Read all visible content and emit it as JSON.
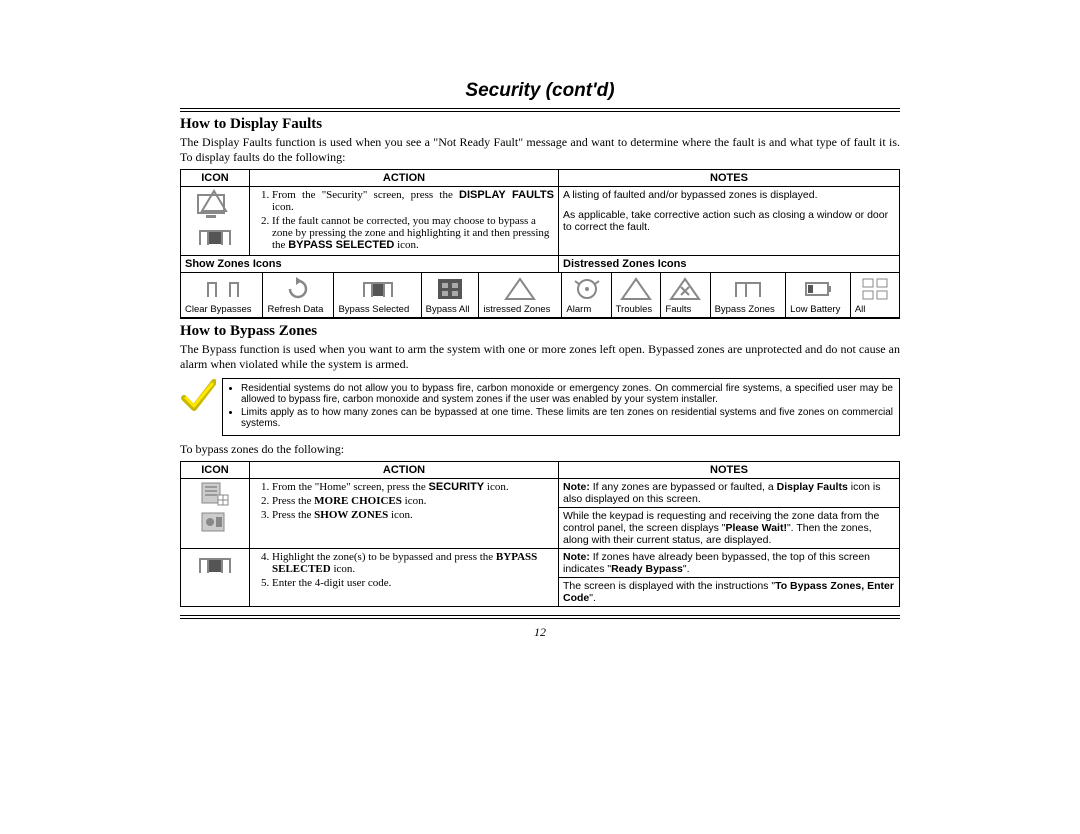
{
  "page_title": "Security (cont'd)",
  "page_number": "12",
  "s1": {
    "title": "How to Display Faults",
    "intro": "The Display Faults function is used when you see a \"Not Ready Fault\" message and want to determine where the fault is and what type of fault it is.  To display faults do the following:",
    "hdr_icon": "ICON",
    "hdr_action": "ACTION",
    "hdr_notes": "NOTES",
    "step1_a": "From the \"Security\" screen, press the ",
    "step1_b": "DISPLAY FAULTS",
    "step1_c": " icon.",
    "step2_a": "If the fault cannot be corrected, you may choose to bypass a zone by pressing the zone and highlighting it and then pressing the ",
    "step2_b": "BYPASS SELECTED",
    "step2_c": " icon.",
    "note1": "A listing of faulted and/or bypassed zones is displayed.",
    "note2": "As applicable, take corrective action such as closing a window or door to correct the fault.",
    "sub_left": "Show Zones Icons",
    "sub_right": "Distressed Zones Icons",
    "icons": [
      "Clear Bypasses",
      "Refresh Data",
      "Bypass Selected",
      "Bypass All",
      "istressed Zones",
      "Alarm",
      "Troubles",
      "Faults",
      "Bypass Zones",
      "Low Battery",
      "All"
    ]
  },
  "s2": {
    "title": "How to Bypass Zones",
    "intro": "The Bypass function is used when you want to arm the system with one or more zones left open. Bypassed zones are unprotected and do not cause an alarm when violated while the system is armed.",
    "bullet1": "Residential systems do not allow you to bypass fire, carbon monoxide or emergency zones. On commercial fire systems, a specified user may be allowed to bypass fire, carbon monoxide and system zones if the user was enabled by your system installer.",
    "bullet2": "Limits apply as to how many zones can be bypassed at one time. These limits are ten zones on residential systems and five zones on commercial systems.",
    "lead": "To bypass zones do the following:",
    "hdr_icon": "ICON",
    "hdr_action": "ACTION",
    "hdr_notes": "NOTES",
    "r1s1_a": "From the \"Home\" screen, press the ",
    "r1s1_b": "SECURITY",
    "r1s1_c": " icon.",
    "r1s2_a": "Press the ",
    "r1s2_b": "MORE CHOICES",
    "r1s2_c": " icon.",
    "r1s3_a": "Press the ",
    "r1s3_b": "SHOW ZONES",
    "r1s3_c": " icon.",
    "r1n1_a": "Note:",
    "r1n1_b": " If any zones are bypassed or faulted, a ",
    "r1n1_c": "Display Faults",
    "r1n1_d": " icon is also displayed on this screen.",
    "r1n2_a": "While the keypad is requesting and receiving the zone data from the control panel, the screen displays \"",
    "r1n2_b": "Please Wait!",
    "r1n2_c": "\".  Then the zones, along with their current status, are displayed.",
    "r2s4_a": "Highlight the zone(s) to be bypassed and press the ",
    "r2s4_b": "BYPASS SELECTED",
    "r2s4_c": " icon.",
    "r2s5": "Enter the 4-digit user code.",
    "r2n1_a": "Note:",
    "r2n1_b": " If zones have already been bypassed, the top of this screen indicates \"",
    "r2n1_c": "Ready Bypass",
    "r2n1_d": "\".",
    "r2n2_a": "The screen is displayed with the instructions \"",
    "r2n2_b": "To Bypass Zones, Enter Code",
    "r2n2_c": "\"."
  }
}
